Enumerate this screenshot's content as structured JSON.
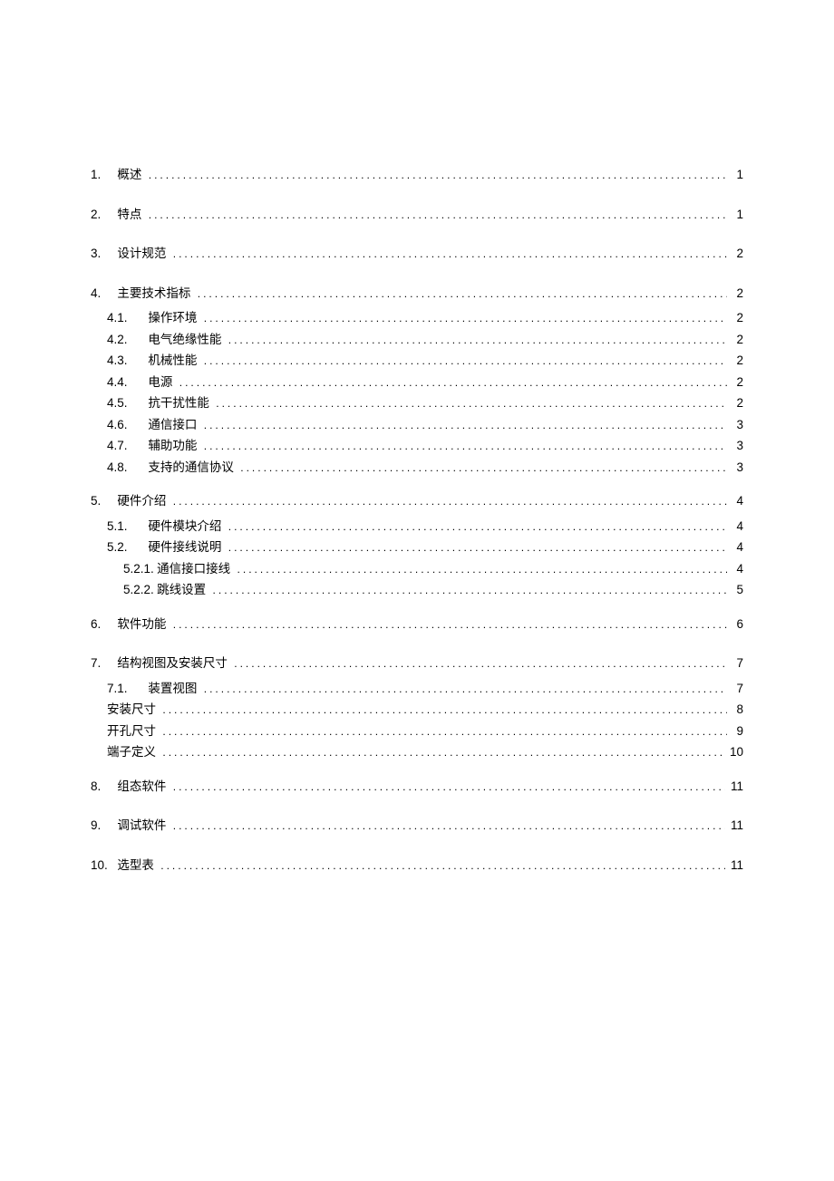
{
  "toc": [
    {
      "level": 1,
      "num": "1.",
      "title": "概述",
      "page": "1",
      "spaced": true
    },
    {
      "level": 1,
      "num": "2.",
      "title": "特点",
      "page": "1",
      "spaced": true
    },
    {
      "level": 1,
      "num": "3.",
      "title": "设计规范",
      "page": "2",
      "spaced": true
    },
    {
      "level": 1,
      "num": "4.",
      "title": "主要技术指标",
      "page": "2",
      "spaced": false
    },
    {
      "level": 2,
      "num": "4.1.",
      "title": "操作环境",
      "page": "2"
    },
    {
      "level": 2,
      "num": "4.2.",
      "title": "电气绝缘性能",
      "page": "2"
    },
    {
      "level": 2,
      "num": "4.3.",
      "title": "机械性能",
      "page": "2"
    },
    {
      "level": 2,
      "num": "4.4.",
      "title": "电源",
      "page": "2"
    },
    {
      "level": 2,
      "num": "4.5.",
      "title": "抗干扰性能",
      "page": "2"
    },
    {
      "level": 2,
      "num": "4.6.",
      "title": "通信接口",
      "page": "3"
    },
    {
      "level": 2,
      "num": "4.7.",
      "title": "辅助功能",
      "page": "3"
    },
    {
      "level": 2,
      "num": "4.8.",
      "title": "支持的通信协议",
      "page": "3"
    },
    {
      "gap": true
    },
    {
      "level": 1,
      "num": "5.",
      "title": "硬件介绍",
      "page": "4",
      "spaced": false
    },
    {
      "level": 2,
      "num": "5.1.",
      "title": "硬件模块介绍",
      "page": "4"
    },
    {
      "level": 2,
      "num": "5.2.",
      "title": "硬件接线说明",
      "page": "4"
    },
    {
      "level": 3,
      "num": "5.2.1.",
      "title": "通信接口接线",
      "page": "4"
    },
    {
      "level": 3,
      "num": "5.2.2.",
      "title": "跳线设置",
      "page": "5"
    },
    {
      "gap": true
    },
    {
      "level": 1,
      "num": "6.",
      "title": "软件功能",
      "page": "6",
      "spaced": true
    },
    {
      "level": 1,
      "num": "7.",
      "title": "结构视图及安装尺寸",
      "page": "7",
      "spaced": false
    },
    {
      "level": 2,
      "num": "7.1.",
      "title": "装置视图",
      "page": "7"
    },
    {
      "level": 2,
      "num": "",
      "title": "安装尺寸",
      "page": "8"
    },
    {
      "level": 2,
      "num": "",
      "title": "开孔尺寸",
      "page": "9"
    },
    {
      "level": 2,
      "num": "",
      "title": "端子定义",
      "page": "10"
    },
    {
      "gap": true
    },
    {
      "level": 1,
      "num": "8.",
      "title": "组态软件",
      "page": "11",
      "spaced": true
    },
    {
      "level": 1,
      "num": "9.",
      "title": "调试软件",
      "page": "11",
      "spaced": true
    },
    {
      "level": 1,
      "num": "10.",
      "title": "选型表",
      "page": "11",
      "spaced": true
    }
  ]
}
